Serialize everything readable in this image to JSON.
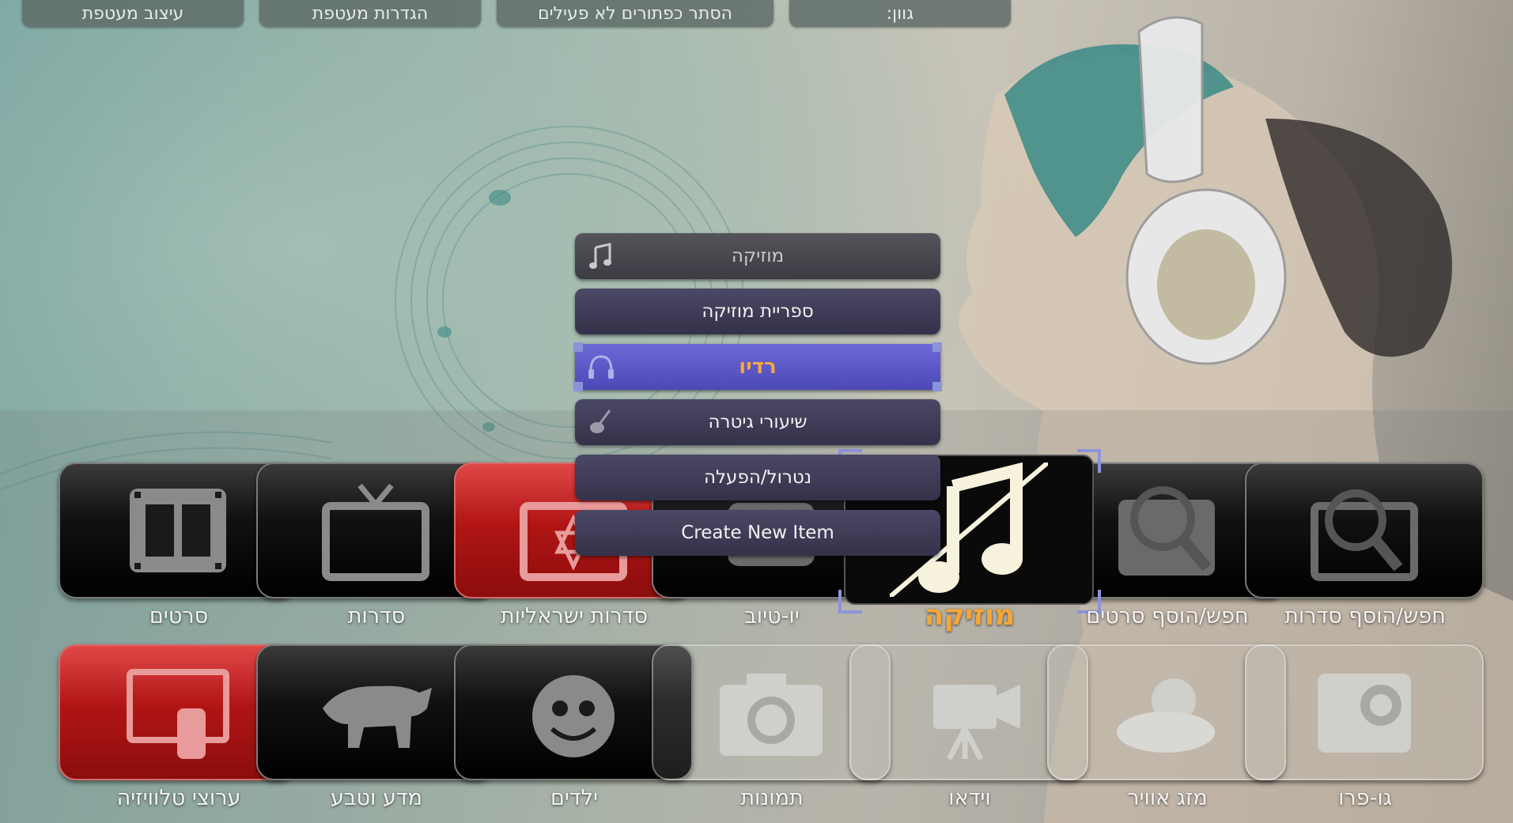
{
  "top_bar": {
    "skin_design": "עיצוב מעטפת",
    "skin_settings": "הגדרות מעטפת",
    "hide_inactive": "הסתר כפתורים לא פעילים",
    "color": "גוון:"
  },
  "menu": {
    "header": "מוזיקה",
    "items": [
      {
        "label": "ספריית מוזיקה"
      },
      {
        "label": "רדיו",
        "selected": true
      },
      {
        "label": "שיעורי גיטרה"
      },
      {
        "label": "נטרול/הפעלה"
      },
      {
        "label": "Create New Item"
      }
    ]
  },
  "row1": [
    {
      "label": "סרטים",
      "icon": "film-icon"
    },
    {
      "label": "סדרות",
      "icon": "tv-icon"
    },
    {
      "label": "סדרות ישראליות",
      "icon": "israeli-tv-icon"
    },
    {
      "label": "יו-טיוב",
      "icon": "youtube-icon"
    },
    {
      "label": "מוזיקה",
      "icon": "music-note-icon",
      "active": true
    },
    {
      "label": "חפש/הוסף סרטים",
      "icon": "search-film-icon"
    },
    {
      "label": "חפש/הוסף סדרות",
      "icon": "search-tv-icon"
    }
  ],
  "row2": [
    {
      "label": "ערוצי טלוויזיה",
      "icon": "tv-remote-icon"
    },
    {
      "label": "מדע וטבע",
      "icon": "tiger-icon"
    },
    {
      "label": "ילדים",
      "icon": "kid-face-icon"
    },
    {
      "label": "תמונות",
      "icon": "camera-icon"
    },
    {
      "label": "וידאו",
      "icon": "video-camera-icon"
    },
    {
      "label": "מזג אוויר",
      "icon": "weather-icon"
    },
    {
      "label": "גו-פרו",
      "icon": "gopro-icon"
    }
  ],
  "colors": {
    "accent": "#f4a636",
    "selection": "#5e5bc9",
    "red_tile": "#b11515"
  }
}
